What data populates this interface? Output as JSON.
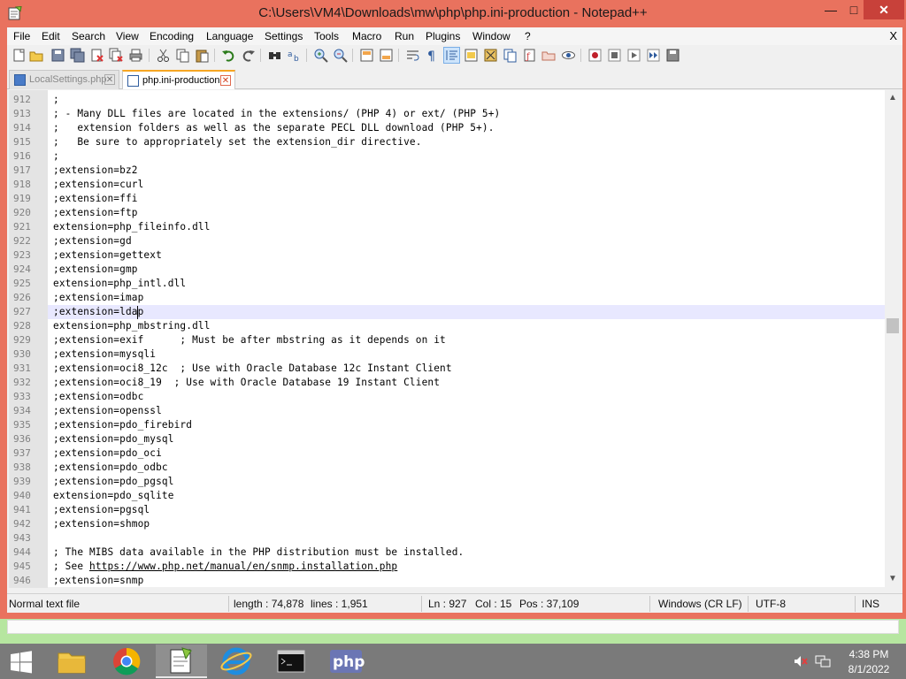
{
  "window": {
    "title": "C:\\Users\\VM4\\Downloads\\mw\\php\\php.ini-production - Notepad++",
    "min_label": "—",
    "max_label": "□",
    "close_label": "✕"
  },
  "menu": {
    "items": [
      "File",
      "Edit",
      "Search",
      "View",
      "Encoding",
      "Language",
      "Settings",
      "Tools",
      "Macro",
      "Run",
      "Plugins",
      "Window",
      "?"
    ],
    "close_label": "X"
  },
  "tabs": [
    {
      "label": "LocalSettings.php",
      "active": false
    },
    {
      "label": "php.ini-production",
      "active": true
    }
  ],
  "editor": {
    "current_line": 927,
    "lines": [
      {
        "n": "912",
        "text": ";"
      },
      {
        "n": "913",
        "text": "; - Many DLL files are located in the extensions/ (PHP 4) or ext/ (PHP 5+)"
      },
      {
        "n": "914",
        "text": ";   extension folders as well as the separate PECL DLL download (PHP 5+)."
      },
      {
        "n": "915",
        "text": ";   Be sure to appropriately set the extension_dir directive."
      },
      {
        "n": "916",
        "text": ";"
      },
      {
        "n": "917",
        "text": ";extension=bz2"
      },
      {
        "n": "918",
        "text": ";extension=curl"
      },
      {
        "n": "919",
        "text": ";extension=ffi"
      },
      {
        "n": "920",
        "text": ";extension=ftp"
      },
      {
        "n": "921",
        "text": "extension=php_fileinfo.dll"
      },
      {
        "n": "922",
        "text": ";extension=gd"
      },
      {
        "n": "923",
        "text": ";extension=gettext"
      },
      {
        "n": "924",
        "text": ";extension=gmp"
      },
      {
        "n": "925",
        "text": "extension=php_intl.dll"
      },
      {
        "n": "926",
        "text": ";extension=imap"
      },
      {
        "n": "927",
        "text": ";extension=ldap"
      },
      {
        "n": "928",
        "text": "extension=php_mbstring.dll"
      },
      {
        "n": "929",
        "text": ";extension=exif      ; Must be after mbstring as it depends on it"
      },
      {
        "n": "930",
        "text": ";extension=mysqli"
      },
      {
        "n": "931",
        "text": ";extension=oci8_12c  ; Use with Oracle Database 12c Instant Client"
      },
      {
        "n": "932",
        "text": ";extension=oci8_19  ; Use with Oracle Database 19 Instant Client"
      },
      {
        "n": "933",
        "text": ";extension=odbc"
      },
      {
        "n": "934",
        "text": ";extension=openssl"
      },
      {
        "n": "935",
        "text": ";extension=pdo_firebird"
      },
      {
        "n": "936",
        "text": ";extension=pdo_mysql"
      },
      {
        "n": "937",
        "text": ";extension=pdo_oci"
      },
      {
        "n": "938",
        "text": ";extension=pdo_odbc"
      },
      {
        "n": "939",
        "text": ";extension=pdo_pgsql"
      },
      {
        "n": "940",
        "text": "extension=pdo_sqlite"
      },
      {
        "n": "941",
        "text": ";extension=pgsql"
      },
      {
        "n": "942",
        "text": ";extension=shmop"
      },
      {
        "n": "943",
        "text": ""
      },
      {
        "n": "944",
        "text": "; The MIBS data available in the PHP distribution must be installed."
      },
      {
        "n": "945",
        "text": "; See ",
        "link": "https://www.php.net/manual/en/snmp.installation.php"
      },
      {
        "n": "946",
        "text": ";extension=snmp"
      }
    ]
  },
  "statusbar": {
    "file_type": "Normal text file",
    "length": "length : 74,878",
    "lines": "lines : 1,951",
    "ln": "Ln : 927",
    "col": "Col : 15",
    "pos": "Pos : 37,109",
    "eol": "Windows (CR LF)",
    "encoding": "UTF-8",
    "mode": "INS"
  },
  "taskbar": {
    "apps": [
      "file-explorer",
      "chrome",
      "notepad-plus-plus",
      "internet-explorer",
      "command-prompt",
      "php"
    ],
    "time": "4:38 PM",
    "date": "8/1/2022"
  },
  "colors": {
    "titlebar": "#e9725e",
    "close_button": "#c8413a",
    "active_tab_accent": "#f6a623",
    "current_line": "#e8e8ff"
  }
}
